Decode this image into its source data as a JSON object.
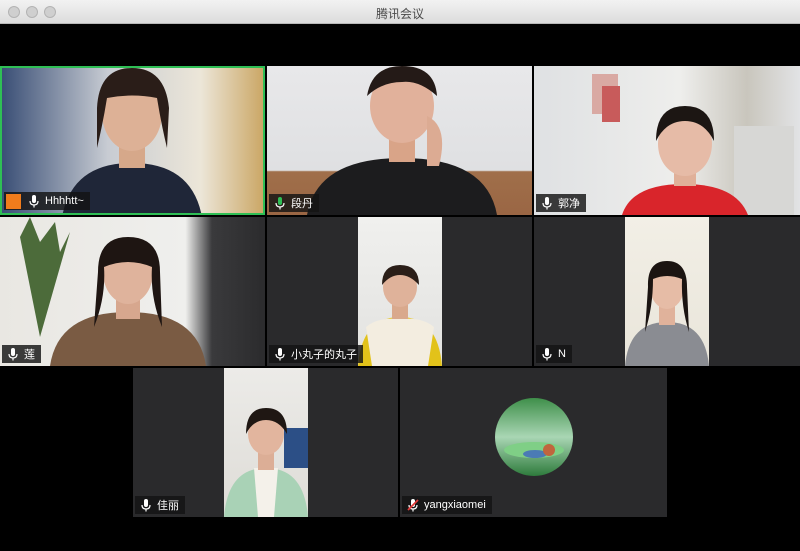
{
  "window": {
    "title": "腾讯会议"
  },
  "participants": [
    {
      "name": "Hhhhtt~",
      "mic": "mic-icon",
      "badge": "host-avatar-icon",
      "speaking": true
    },
    {
      "name": "段丹",
      "mic": "mic-active-icon"
    },
    {
      "name": "郭净",
      "mic": "mic-icon"
    },
    {
      "name": "莲",
      "mic": "mic-icon"
    },
    {
      "name": "小丸子的丸子",
      "mic": "mic-icon"
    },
    {
      "name": "N",
      "mic": "mic-icon"
    },
    {
      "name": "佳丽",
      "mic": "mic-icon"
    },
    {
      "name": "yangxiaomei",
      "mic": "mic-muted-icon",
      "camera_off": true
    }
  ],
  "colors": {
    "active_border": "#2fbf55",
    "tile_bg": "#2a2a2c",
    "title_bar": "#e6e6e6",
    "active_mic": "#2fbf55",
    "muted_mic": "#e23b3b"
  }
}
